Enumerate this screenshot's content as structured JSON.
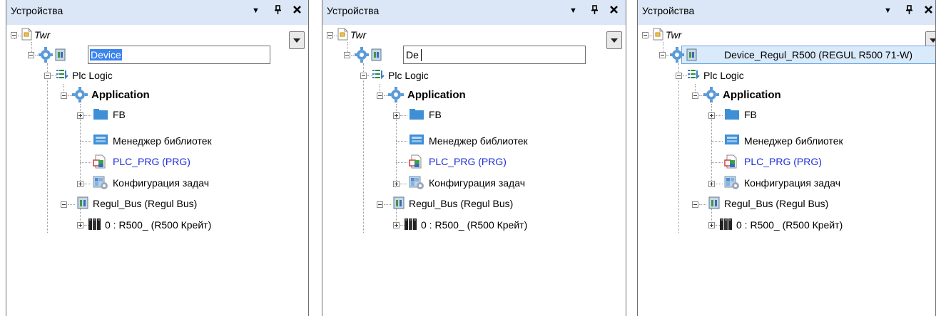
{
  "panels": [
    {
      "title": "Устройства",
      "edit_value": "Device",
      "edit_mode": "selected"
    },
    {
      "title": "Устройства",
      "edit_value": "De",
      "edit_mode": "caret"
    },
    {
      "title": "Устройства",
      "edit_value": "Device_Regul_R500 (REGUL R500 71-W)",
      "edit_mode": "committed"
    }
  ],
  "tree": {
    "root": "Twr",
    "plc_logic": "Plc Logic",
    "application": "Application",
    "fb": "FB",
    "library_manager": "Менеджер библиотек",
    "plc_prg": "PLC_PRG (PRG)",
    "task_config": "Конфигурация задач",
    "regul_bus": "Regul_Bus (Regul Bus)",
    "crate": "0 : R500_ (R500 Крейт)"
  },
  "titlebar_buttons": {
    "menu": "▼",
    "pin": "ᵖ",
    "close": "✕"
  },
  "colors": {
    "titlebar": "#dbe7f6",
    "selection": "#3a84f0",
    "link": "#1a2bd9"
  }
}
